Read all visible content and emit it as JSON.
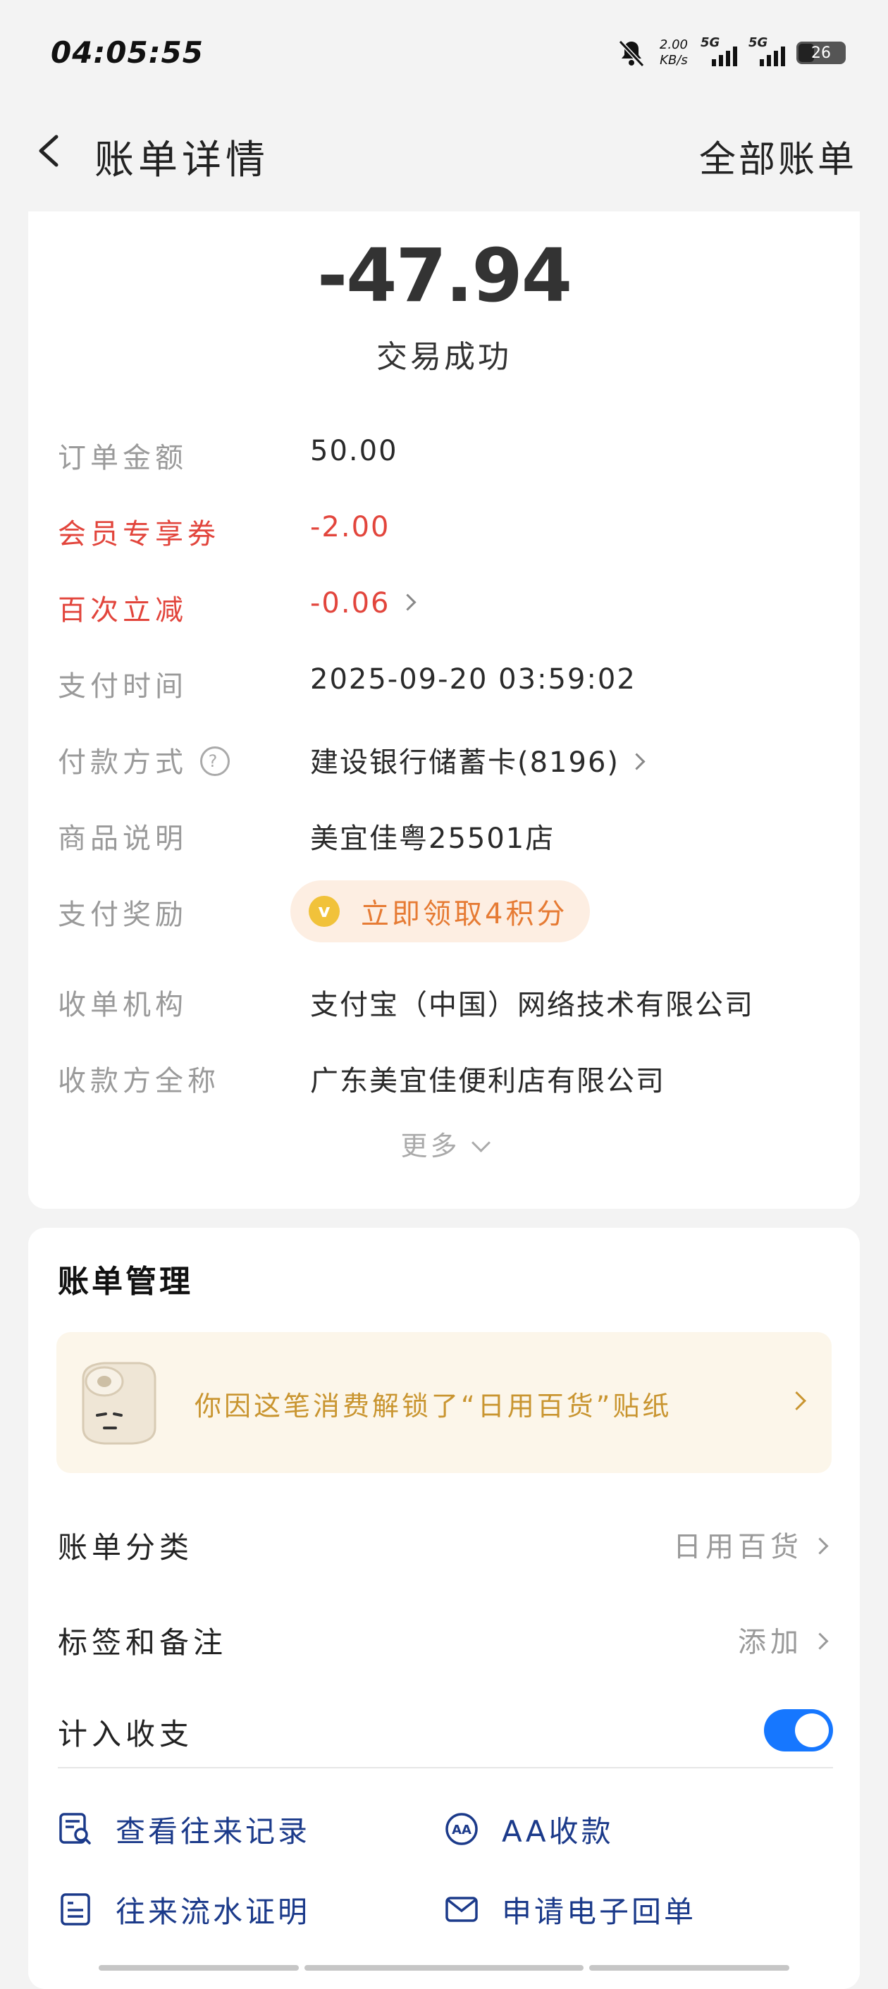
{
  "status_bar": {
    "time": "04:05:55",
    "net_speed_value": "2.00",
    "net_speed_unit": "KB/s",
    "sim1": "5G",
    "sim2": "5G",
    "battery": "26"
  },
  "nav": {
    "title": "账单详情",
    "all_bills": "全部账单"
  },
  "summary": {
    "amount": "-47.94",
    "status": "交易成功"
  },
  "details": [
    {
      "label": "订单金额",
      "value": "50.00"
    },
    {
      "label": "会员专享券",
      "value": "-2.00"
    },
    {
      "label": "百次立减",
      "value": "-0.06"
    },
    {
      "label": "支付时间",
      "value": "2025-09-20 03:59:02"
    },
    {
      "label": "付款方式",
      "value": "建设银行储蓄卡(8196)"
    },
    {
      "label": "商品说明",
      "value": "美宜佳粤25501店"
    },
    {
      "label": "支付奖励",
      "value": "立即领取4积分"
    },
    {
      "label": "收单机构",
      "value": "支付宝（中国）网络技术有限公司"
    },
    {
      "label": "收款方全称",
      "value": "广东美宜佳便利店有限公司"
    }
  ],
  "more_label": "更多",
  "management": {
    "title": "账单管理",
    "banner_text": "你因这笔消费解锁了“日用百货”贴纸",
    "category_label": "账单分类",
    "category_value": "日用百货",
    "tags_label": "标签和备注",
    "tags_value": "添加",
    "include_label": "计入收支",
    "include_on": true,
    "actions": [
      {
        "label": "查看往来记录",
        "icon": "records-search-icon"
      },
      {
        "label": "AA收款",
        "icon": "aa-icon"
      },
      {
        "label": "往来流水证明",
        "icon": "statement-icon"
      },
      {
        "label": "申请电子回单",
        "icon": "envelope-icon"
      }
    ]
  },
  "colors": {
    "accent": "#1677ff",
    "discount_red": "#e2453c",
    "reward_orange": "#e67b34",
    "banner_gold": "#c99530"
  }
}
